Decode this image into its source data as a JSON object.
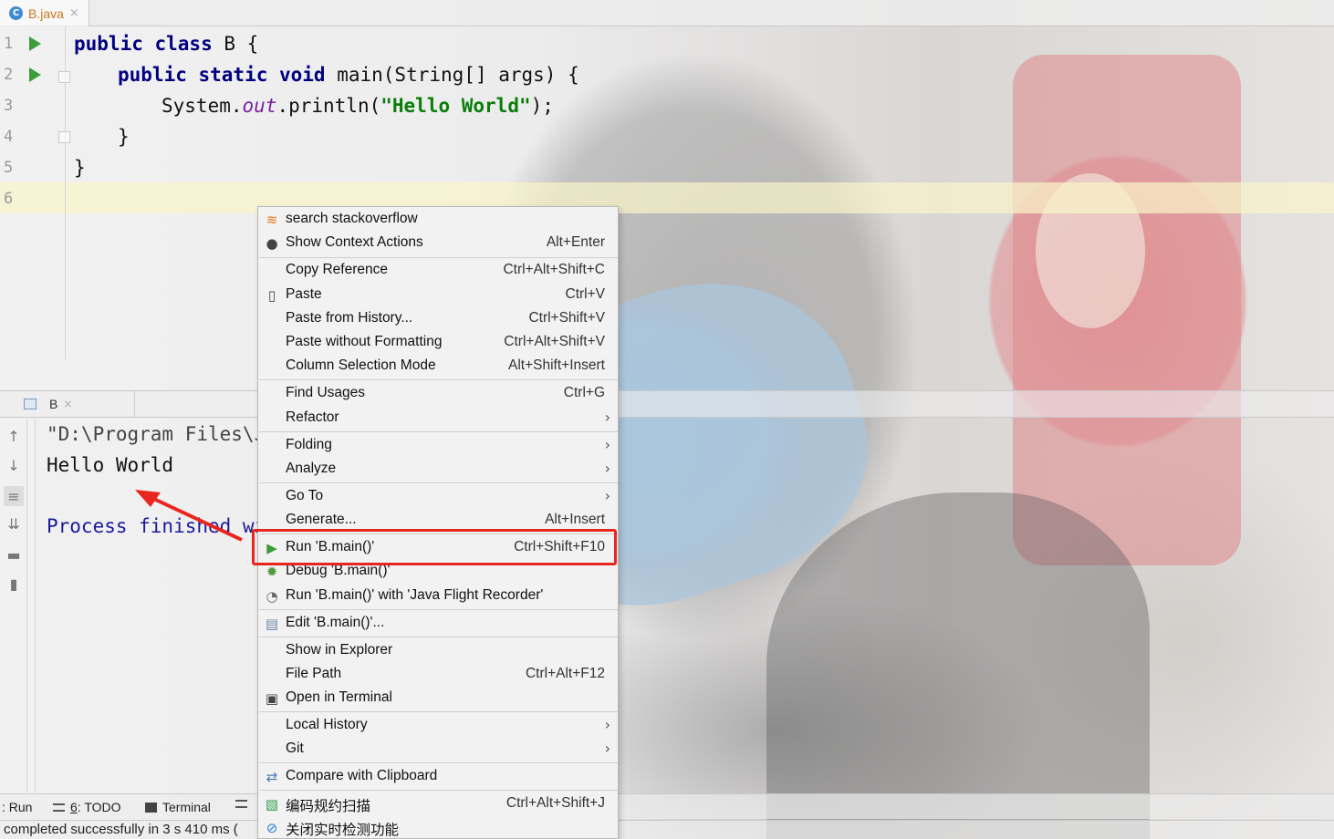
{
  "editor": {
    "tab": {
      "icon": "C",
      "label": "B.java",
      "close": "×"
    },
    "line_numbers": [
      "1",
      "2",
      "3",
      "4",
      "5",
      "6"
    ],
    "code": {
      "l1_kw": "public class",
      "l1_rest": " B {",
      "l2_kw": "public static void",
      "l2_rest": " main(String[] args) {",
      "l3_pre": "System.",
      "l3_field": "out",
      "l3_mid": ".println(",
      "l3_str": "\"Hello World\"",
      "l3_end": ");",
      "l4": "}",
      "l5": "}"
    }
  },
  "run_panel": {
    "tab_label": "B",
    "tab_close": "×",
    "console": {
      "line1": "\"D:\\Program Files\\Ja",
      "line2": "Hello World",
      "line3": "Process finished wi"
    }
  },
  "context_menu": {
    "items": [
      {
        "label": "search stackoverflow",
        "shortcut": "",
        "icon": "stackoverflow-icon"
      },
      {
        "label": "Show Context Actions",
        "shortcut": "Alt+Enter",
        "icon": "bulb-icon"
      },
      {
        "label": "Copy Reference",
        "shortcut": "Ctrl+Alt+Shift+C"
      },
      {
        "label": "Paste",
        "shortcut": "Ctrl+V",
        "icon": "clipboard-icon"
      },
      {
        "label": "Paste from History...",
        "shortcut": "Ctrl+Shift+V"
      },
      {
        "label": "Paste without Formatting",
        "shortcut": "Ctrl+Alt+Shift+V"
      },
      {
        "label": "Column Selection Mode",
        "shortcut": "Alt+Shift+Insert"
      },
      {
        "label": "Find Usages",
        "shortcut": "Ctrl+G"
      },
      {
        "label": "Refactor",
        "shortcut": ""
      },
      {
        "label": "Folding",
        "shortcut": ""
      },
      {
        "label": "Analyze",
        "shortcut": ""
      },
      {
        "label": "Go To",
        "shortcut": ""
      },
      {
        "label": "Generate...",
        "shortcut": "Alt+Insert"
      },
      {
        "label": "Run 'B.main()'",
        "shortcut": "Ctrl+Shift+F10",
        "icon": "run-icon"
      },
      {
        "label": "Debug 'B.main()'",
        "shortcut": "",
        "icon": "debug-icon"
      },
      {
        "label": "Run 'B.main()' with 'Java Flight Recorder'",
        "shortcut": "",
        "icon": "profiler-icon"
      },
      {
        "label": "Edit 'B.main()'...",
        "shortcut": "",
        "icon": "edit-config-icon"
      },
      {
        "label": "Show in Explorer",
        "shortcut": ""
      },
      {
        "label": "File Path",
        "shortcut": "Ctrl+Alt+F12"
      },
      {
        "label": "Open in Terminal",
        "shortcut": "",
        "icon": "terminal-icon"
      },
      {
        "label": "Local History",
        "shortcut": ""
      },
      {
        "label": "Git",
        "shortcut": ""
      },
      {
        "label": "Compare with Clipboard",
        "shortcut": "",
        "icon": "compare-icon"
      },
      {
        "label": "编码规约扫描",
        "shortcut": "Ctrl+Alt+Shift+J",
        "icon": "scan-icon"
      },
      {
        "label": "关闭实时检测功能",
        "shortcut": "",
        "icon": "disable-icon"
      }
    ],
    "submenu_arrow": "›"
  },
  "bottom_tools": {
    "run": ": Run",
    "todo_num": "6",
    "todo": ": TODO",
    "terminal": "Terminal"
  },
  "status": {
    "text": "completed successfully in 3 s 410 ms ("
  },
  "colors": {
    "highlight_box": "#e8261f",
    "run_green": "#3b9e3b",
    "keyword": "#000080",
    "string": "#0a7d0a"
  }
}
